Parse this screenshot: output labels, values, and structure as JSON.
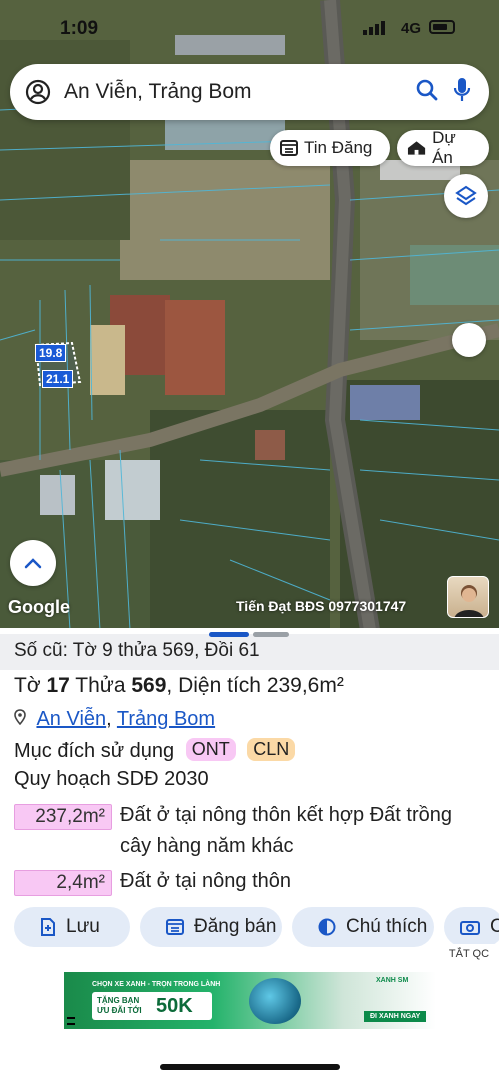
{
  "status_bar": {
    "time": "1:09",
    "network": "4G"
  },
  "search": {
    "query": "An Viễn, Trảng Bom"
  },
  "map_chips": {
    "tin_dang": "Tin Đăng",
    "du_an": "Dự Án"
  },
  "plot_labels": {
    "width": "19.8",
    "length": "21.1"
  },
  "map_footer": {
    "logo": "Google",
    "watermark": "Tiến Đạt BĐS 0977301747"
  },
  "sheet": {
    "old_info": "Số cũ: Tờ 9 thửa 569, Đồi 61",
    "parcel": {
      "to_label": "Tờ",
      "to_value": "17",
      "thua_label": "Thửa",
      "thua_value": "569",
      "area_label": ", Diện tích",
      "area_value": "239,6m²"
    },
    "location": {
      "commune": "An Viễn",
      "sep": ",",
      "district": "Trảng Bom"
    },
    "usage": {
      "label": "Mục đích sử dụng",
      "tags": [
        "ONT",
        "CLN"
      ]
    },
    "planning": "Quy hoạch SDĐ 2030",
    "areas": [
      {
        "value": "237,2m²",
        "desc_line1": "Đất ở tại nông thôn kết hợp Đất trồng",
        "desc_line2": "cây hàng năm khác"
      },
      {
        "value": "2,4m²",
        "desc_line1": "Đất ở tại nông thôn",
        "desc_line2": ""
      }
    ],
    "actions": {
      "save": "Lưu",
      "post_sale": "Đăng bán",
      "legend": "Chú thích",
      "capture": "C"
    }
  },
  "ad": {
    "close_label": "TẮT QC",
    "headline": "CHỌN XE XANH - TRỌN TRONG LÀNH",
    "offer_line1": "TẶNG BẠN",
    "offer_line2": "ƯU ĐÃI TỚI",
    "offer_amount": "50K",
    "cta": "ĐI XANH NGAY",
    "brand": "XANH SM"
  },
  "colors": {
    "accent": "#1a57c6",
    "ont_tag": "#f8c8f4",
    "cln_tag": "#fbd9a6",
    "area_highlight": "#f8c8f4",
    "action_bg": "#e3ebf7"
  }
}
